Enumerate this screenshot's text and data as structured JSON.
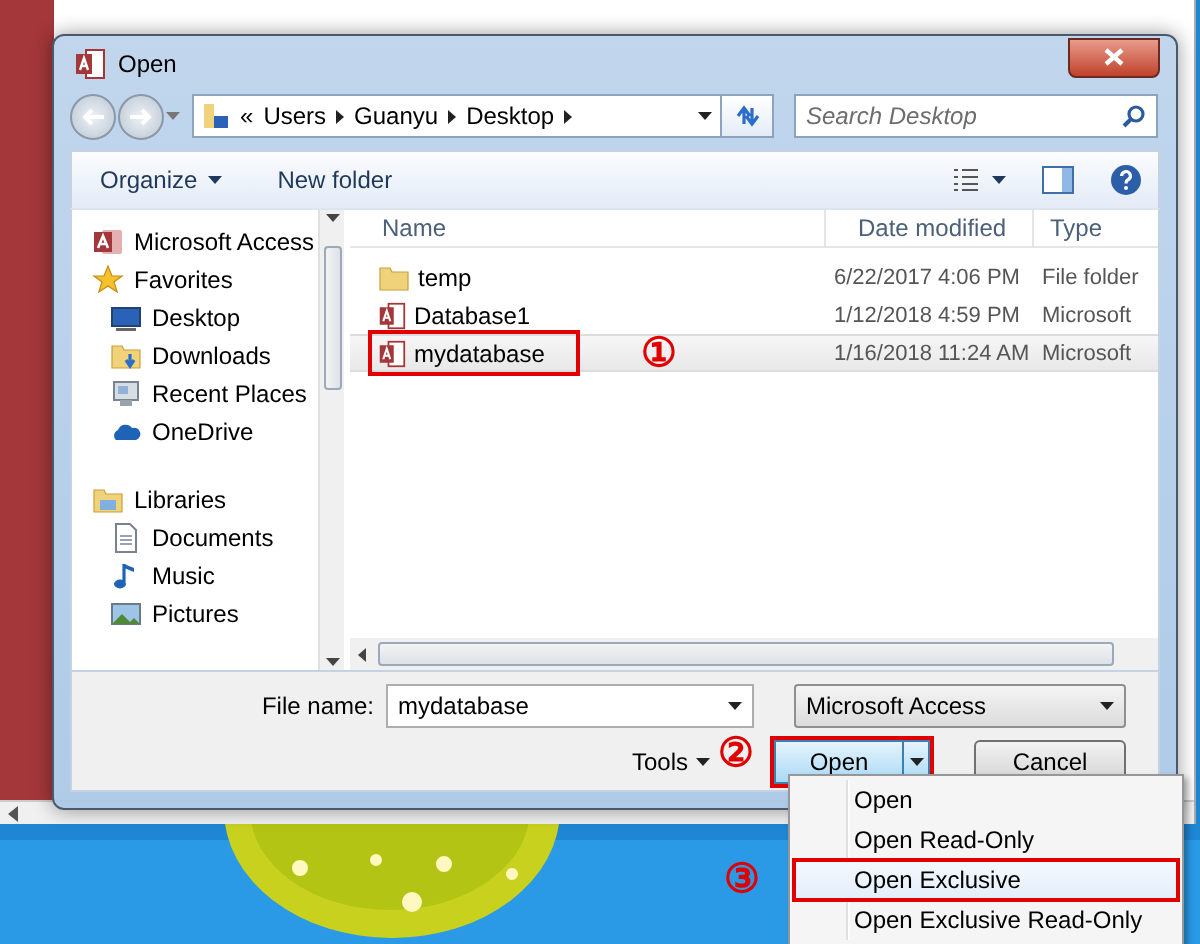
{
  "window": {
    "title": "Open"
  },
  "address": {
    "segments": [
      "Users",
      "Guanyu",
      "Desktop"
    ],
    "overflow": "«"
  },
  "search": {
    "placeholder": "Search Desktop"
  },
  "toolbar": {
    "organize": "Organize",
    "new_folder": "New folder"
  },
  "sidebar": {
    "items": [
      {
        "label": "Microsoft Access",
        "kind": "access"
      },
      {
        "label": "Favorites",
        "kind": "star",
        "children": [
          {
            "label": "Desktop",
            "kind": "desktop"
          },
          {
            "label": "Downloads",
            "kind": "downloads"
          },
          {
            "label": "Recent Places",
            "kind": "recent"
          },
          {
            "label": "OneDrive",
            "kind": "cloud"
          }
        ]
      },
      {
        "label": "Libraries",
        "kind": "libraries",
        "children": [
          {
            "label": "Documents",
            "kind": "documents"
          },
          {
            "label": "Music",
            "kind": "music"
          },
          {
            "label": "Pictures",
            "kind": "pictures"
          }
        ]
      }
    ]
  },
  "files": {
    "columns": [
      "Name",
      "Date modified",
      "Type"
    ],
    "rows": [
      {
        "name": "temp",
        "date": "6/22/2017 4:06 PM",
        "type": "File folder",
        "kind": "folder",
        "selected": false,
        "annotated": false
      },
      {
        "name": "Database1",
        "date": "1/12/2018 4:59 PM",
        "type": "Microsoft",
        "kind": "access",
        "selected": false,
        "annotated": false
      },
      {
        "name": "mydatabase",
        "date": "1/16/2018 11:24 AM",
        "type": "Microsoft",
        "kind": "access",
        "selected": true,
        "annotated": true,
        "callout": "①"
      }
    ]
  },
  "bottom": {
    "file_name_label": "File name:",
    "file_name": "mydatabase",
    "filter": "Microsoft Access",
    "tools": "Tools",
    "open": "Open",
    "open_annotated": true,
    "open_callout": "②",
    "cancel": "Cancel"
  },
  "menu": {
    "items": [
      {
        "label": "Open",
        "selected": false,
        "annotated": false
      },
      {
        "label": "Open Read-Only",
        "selected": false,
        "annotated": false
      },
      {
        "label": "Open Exclusive",
        "selected": true,
        "annotated": true,
        "callout": "③"
      },
      {
        "label": "Open Exclusive Read-Only",
        "selected": false,
        "annotated": false
      }
    ]
  }
}
